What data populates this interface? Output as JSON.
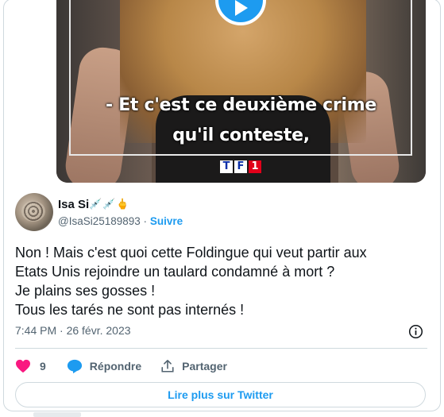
{
  "media": {
    "subtitle_line1": "- Et c'est ce deuxième crime",
    "subtitle_line2": "qu'il conteste,",
    "channel_logo_letters": [
      "T",
      "F",
      "1"
    ]
  },
  "author": {
    "display_name": "Isa Si",
    "name_emojis": "💉💉🖕",
    "handle": "@IsaSi25189893",
    "separator": "·",
    "follow_label": "Suivre"
  },
  "tweet": {
    "lines": [
      "Non ! Mais c'est quoi cette Foldingue qui veut partir aux",
      "Etats Unis rejoindre un taulard condamné à mort ?",
      "Je plains ses gosses !",
      "Tous les tarés ne sont pas internés !"
    ],
    "timestamp": "7:44 PM · 26 févr. 2023"
  },
  "actions": {
    "like_count": "9",
    "reply_label": "Répondre",
    "share_label": "Partager"
  },
  "read_more_label": "Lire plus sur Twitter",
  "colors": {
    "accent": "#1d9bf0",
    "like": "#f91880",
    "muted": "#536471",
    "border": "#cfd9de"
  }
}
